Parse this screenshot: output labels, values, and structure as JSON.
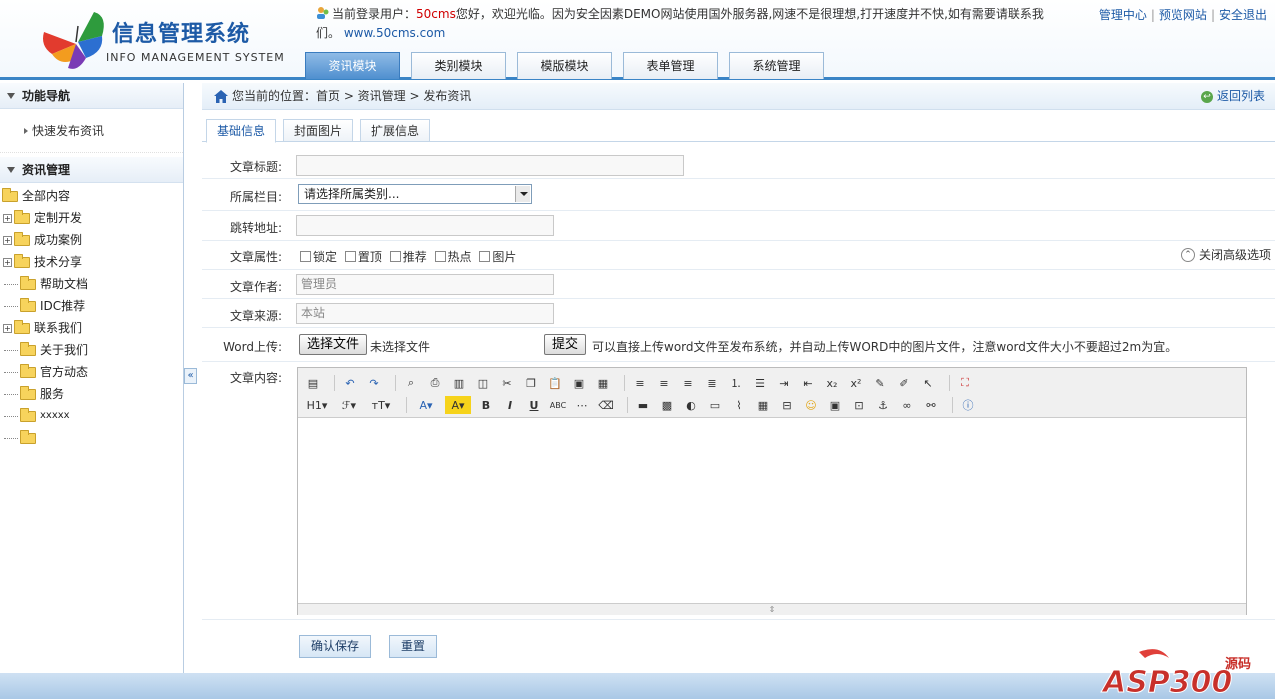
{
  "header": {
    "logo_title": "信息管理系统",
    "logo_subtitle": "INFO MANAGEMENT SYSTEM",
    "user_prefix": "当前登录用户：",
    "username": "50cms",
    "user_suffix": "您好，欢迎光临。因为安全因素DEMO网站使用国外服务器,网速不是很理想,打开速度并不快,如有需要请联系我们。",
    "site_url": "www.50cms.com",
    "links": [
      "管理中心",
      "预览网站",
      "安全退出"
    ]
  },
  "nav_tabs": [
    "资讯模块",
    "类别模块",
    "模版模块",
    "表单管理",
    "系统管理"
  ],
  "sidebar": {
    "nav_title": "功能导航",
    "quick_link": "快速发布资讯",
    "section_title": "资讯管理",
    "tree": [
      "全部内容",
      "定制开发",
      "成功案例",
      "技术分享",
      "帮助文档",
      "IDC推荐",
      "联系我们",
      "关于我们",
      "官方动态",
      "服务",
      "xxxxx",
      ""
    ]
  },
  "breadcrumb": {
    "text": "您当前的位置：首页 > 资讯管理 > 发布资讯",
    "back": "返回列表"
  },
  "subtabs": [
    "基础信息",
    "封面图片",
    "扩展信息"
  ],
  "form": {
    "title_label": "文章标题:",
    "title_value": "",
    "category_label": "所属栏目:",
    "category_value": "请选择所属类别...",
    "redirect_label": "跳转地址:",
    "redirect_value": "",
    "attr_label": "文章属性:",
    "attrs": [
      "锁定",
      "置顶",
      "推荐",
      "热点",
      "图片"
    ],
    "advanced_toggle": "关闭高级选项",
    "author_label": "文章作者:",
    "author_placeholder": "管理员",
    "source_label": "文章来源:",
    "source_placeholder": "本站",
    "word_label": "Word上传:",
    "choose_file": "选择文件",
    "no_file": "未选择文件",
    "submit_upload": "提交",
    "word_hint": "可以直接上传word文件至发布系统，并自动上传WORD中的图片文件，注意word文件大小不要超过2m为宜。",
    "content_label": "文章内容:",
    "save_button": "确认保存",
    "reset_button": "重置"
  },
  "watermark": "ASP300源码",
  "colors": {
    "accent": "#1d5aa6",
    "username": "#d00000",
    "tab_active": "#4f8fcf"
  }
}
